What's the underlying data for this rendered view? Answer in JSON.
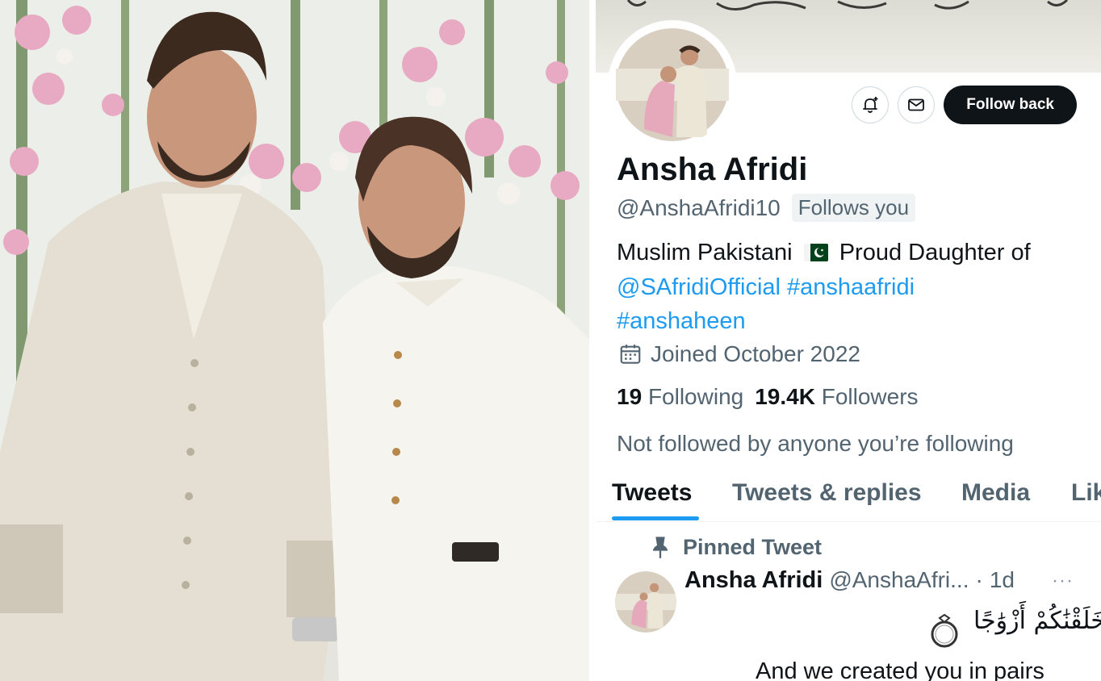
{
  "profile": {
    "display_name": "Ansha Afridi",
    "handle": "@AnshaAfridi10",
    "follows_you_badge": "Follows you",
    "follow_button_label": "Follow back",
    "bio": {
      "line1_before_flag": "Muslim Pakistani",
      "line1_after_flag": "Proud Daughter of",
      "mention": "@SAfridiOfficial",
      "hashtag1": "#anshaafridi",
      "hashtag2": "#anshaheen"
    },
    "joined": "Joined October 2022",
    "following_count": "19",
    "following_label": "Following",
    "followers_count": "19.4K",
    "followers_label": "Followers",
    "not_followed_text": "Not followed by anyone you’re following"
  },
  "tabs": [
    {
      "label": "Tweets",
      "active": true
    },
    {
      "label": "Tweets & replies",
      "active": false
    },
    {
      "label": "Media",
      "active": false
    },
    {
      "label": "Lik",
      "active": false
    }
  ],
  "pinned_tweet": {
    "pinned_label": "Pinned Tweet",
    "author_name": "Ansha Afridi",
    "author_handle": "@AnshaAfri...",
    "separator": "·",
    "time": "1d",
    "more": "···",
    "arabic_text": "وَخَلَقْنَٰكُمْ أَزْوَٰجًا",
    "text": "And we created you in pairs"
  },
  "icons": {
    "notify": "bell-plus-icon",
    "message": "envelope-icon",
    "calendar": "calendar-icon",
    "pin": "pin-icon",
    "flag": "pakistan-flag-icon",
    "ring": "ring-icon"
  },
  "colors": {
    "link": "#1d9bf0",
    "text_primary": "#0f1419",
    "text_secondary": "#536471",
    "follow_button_bg": "#0f1419"
  }
}
